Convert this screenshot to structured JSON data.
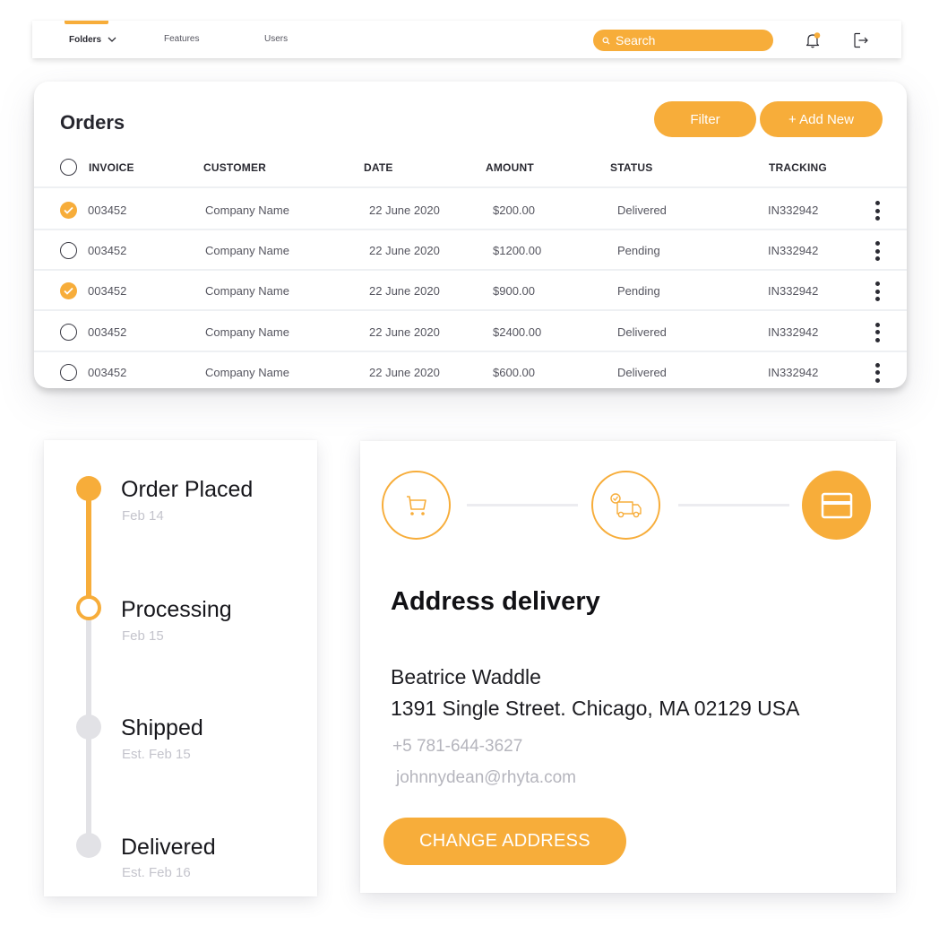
{
  "theme": {
    "accent": "#f7ad3a",
    "text": "#2b2b33",
    "muted": "#b5b5bd",
    "divider": "#eef0f3"
  },
  "nav": {
    "items": [
      {
        "label": "Folders",
        "active": true,
        "has_dropdown": true
      },
      {
        "label": "Features",
        "active": false
      },
      {
        "label": "Users",
        "active": false
      }
    ],
    "search": {
      "placeholder": "Search",
      "value": ""
    },
    "notifications_icon": "bell-icon",
    "notification_badge": true,
    "logout_icon": "logout-icon"
  },
  "orders": {
    "title": "Orders",
    "filter_label": "Filter",
    "add_new_label": "+ Add New",
    "columns": [
      "INVOICE",
      "CUSTOMER",
      "DATE",
      "AMOUNT",
      "STATUS",
      "TRACKING"
    ],
    "select_all_checked": false,
    "rows": [
      {
        "checked": true,
        "invoice": "003452",
        "customer": "Company Name",
        "date": "22 June 2020",
        "amount": "$200.00",
        "status": "Delivered",
        "tracking": "IN332942"
      },
      {
        "checked": false,
        "invoice": "003452",
        "customer": "Company Name",
        "date": "22 June 2020",
        "amount": "$1200.00",
        "status": "Pending",
        "tracking": "IN332942"
      },
      {
        "checked": true,
        "invoice": "003452",
        "customer": "Company Name",
        "date": "22 June 2020",
        "amount": "$900.00",
        "status": "Pending",
        "tracking": "IN332942"
      },
      {
        "checked": false,
        "invoice": "003452",
        "customer": "Company Name",
        "date": "22 June 2020",
        "amount": "$2400.00",
        "status": "Delivered",
        "tracking": "IN332942"
      },
      {
        "checked": false,
        "invoice": "003452",
        "customer": "Company Name",
        "date": "22 June 2020",
        "amount": "$600.00",
        "status": "Delivered",
        "tracking": "IN332942"
      }
    ]
  },
  "timeline": {
    "steps": [
      {
        "title": "Order Placed",
        "date": "Feb 14",
        "state": "done"
      },
      {
        "title": "Processing",
        "date": "Feb 15",
        "state": "current"
      },
      {
        "title": "Shipped",
        "date": "Est. Feb 15",
        "state": "pending"
      },
      {
        "title": "Delivered",
        "date": "Est. Feb 16",
        "state": "pending"
      }
    ]
  },
  "checkout": {
    "steps": [
      {
        "icon": "cart-icon",
        "state": "outline"
      },
      {
        "icon": "delivery-truck-icon",
        "state": "outline"
      },
      {
        "icon": "credit-card-icon",
        "state": "filled"
      }
    ],
    "title": "Address delivery",
    "name": "Beatrice Waddle",
    "address": "1391 Single Street. Chicago, MA 02129 USA",
    "phone": "+5 781-644-3627",
    "email": "johnnydean@rhyta.com",
    "change_label": "CHANGE ADDRESS"
  }
}
